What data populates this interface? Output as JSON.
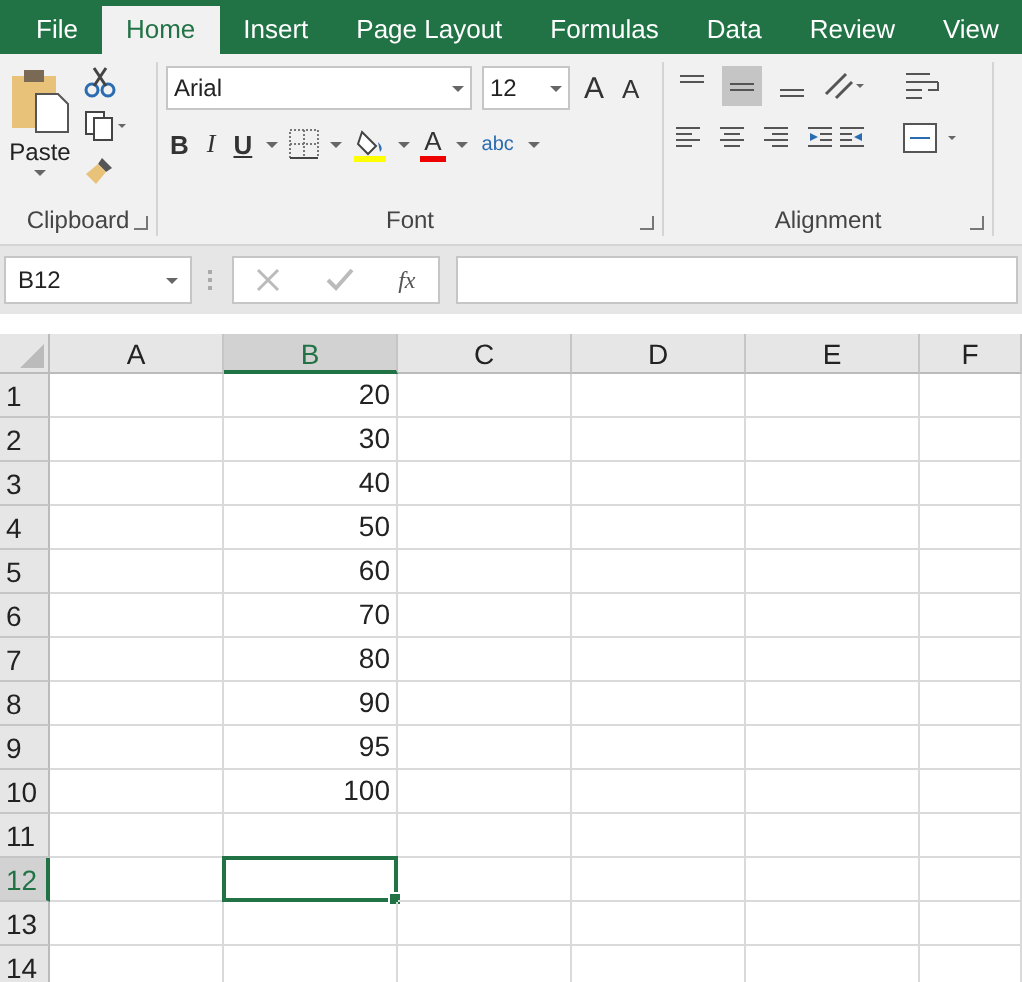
{
  "tabs": [
    {
      "label": "File",
      "selected": false
    },
    {
      "label": "Home",
      "selected": true
    },
    {
      "label": "Insert",
      "selected": false
    },
    {
      "label": "Page Layout",
      "selected": false
    },
    {
      "label": "Formulas",
      "selected": false
    },
    {
      "label": "Data",
      "selected": false
    },
    {
      "label": "Review",
      "selected": false
    },
    {
      "label": "View",
      "selected": false
    }
  ],
  "ribbon": {
    "clipboard": {
      "paste": "Paste",
      "label": "Clipboard"
    },
    "font": {
      "font_name": "Arial",
      "font_size": "12",
      "grow": "A",
      "shrink": "A",
      "bold": "B",
      "italic": "I",
      "underline": "U",
      "font_color": "A",
      "styles": "abc",
      "label": "Font"
    },
    "alignment": {
      "vertical": [
        {
          "kind": "top",
          "selected": false
        },
        {
          "kind": "middle",
          "selected": true
        },
        {
          "kind": "bottom",
          "selected": false
        }
      ],
      "label": "Alignment"
    }
  },
  "formula_bar": {
    "name_box": "B12",
    "fx": "fx"
  },
  "sheet": {
    "columns": [
      {
        "label": "A",
        "selected": false
      },
      {
        "label": "B",
        "selected": true
      },
      {
        "label": "C",
        "selected": false
      },
      {
        "label": "D",
        "selected": false
      },
      {
        "label": "E",
        "selected": false
      },
      {
        "label": "F",
        "selected": false
      }
    ],
    "rows": [
      {
        "label": "1",
        "selected": false,
        "b": "20"
      },
      {
        "label": "2",
        "selected": false,
        "b": "30"
      },
      {
        "label": "3",
        "selected": false,
        "b": "40"
      },
      {
        "label": "4",
        "selected": false,
        "b": "50"
      },
      {
        "label": "5",
        "selected": false,
        "b": "60"
      },
      {
        "label": "6",
        "selected": false,
        "b": "70"
      },
      {
        "label": "7",
        "selected": false,
        "b": "80"
      },
      {
        "label": "8",
        "selected": false,
        "b": "90"
      },
      {
        "label": "9",
        "selected": false,
        "b": "95"
      },
      {
        "label": "10",
        "selected": false,
        "b": "100"
      },
      {
        "label": "11",
        "selected": false
      },
      {
        "label": "12",
        "selected": true
      },
      {
        "label": "13",
        "selected": false
      },
      {
        "label": "14",
        "selected": false
      }
    ]
  }
}
